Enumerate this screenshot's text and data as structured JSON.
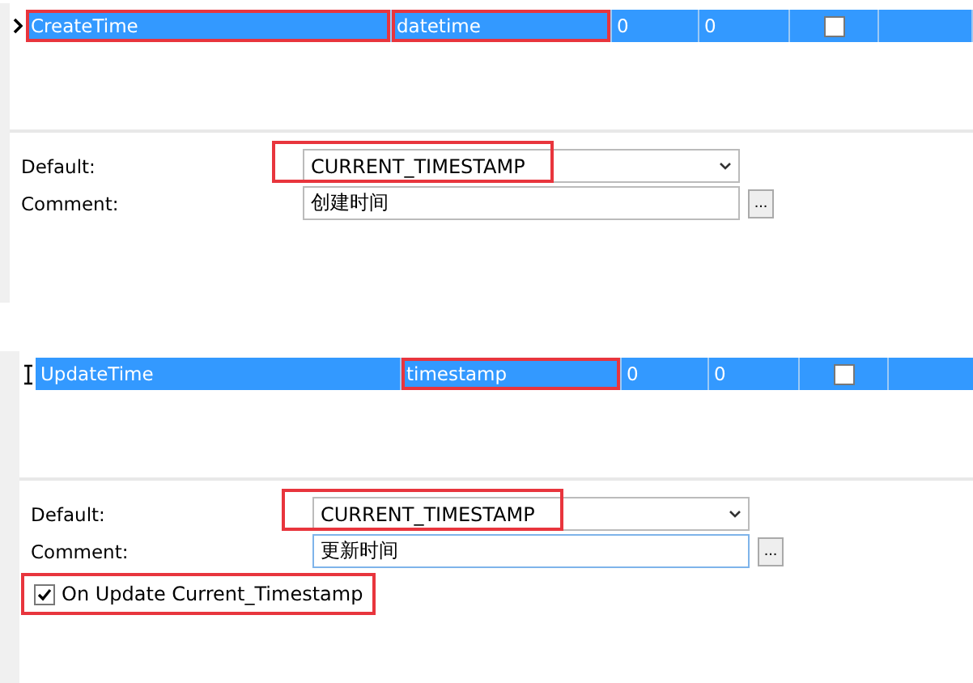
{
  "panels": [
    {
      "row": {
        "kind": "pointer",
        "selected": true,
        "cells": [
          {
            "kind": "text",
            "text": "CreateTime",
            "highlighted": true
          },
          {
            "kind": "text",
            "text": "datetime",
            "highlighted": true
          },
          {
            "kind": "text",
            "text": "0",
            "highlighted": false
          },
          {
            "kind": "text",
            "text": "0",
            "highlighted": false
          },
          {
            "kind": "check",
            "checked": false,
            "highlighted": false
          },
          {
            "kind": "text",
            "text": "",
            "highlighted": false
          }
        ]
      },
      "default": {
        "label": "Default:",
        "value": "CURRENT_TIMESTAMP",
        "highlighted": true
      },
      "comment": {
        "label": "Comment:",
        "value": "创建时间",
        "focused": false,
        "button": "..."
      }
    },
    {
      "row": {
        "kind": "editing",
        "selected": true,
        "cells": [
          {
            "kind": "text",
            "text": "UpdateTime",
            "highlighted": false
          },
          {
            "kind": "text",
            "text": "timestamp",
            "highlighted": true
          },
          {
            "kind": "text",
            "text": "0",
            "highlighted": false
          },
          {
            "kind": "text",
            "text": "0",
            "highlighted": false
          },
          {
            "kind": "check",
            "checked": false,
            "highlighted": false
          },
          {
            "kind": "text",
            "text": "",
            "highlighted": false
          }
        ]
      },
      "default": {
        "label": "Default:",
        "value": "CURRENT_TIMESTAMP",
        "highlighted": true
      },
      "comment": {
        "label": "Comment:",
        "value": "更新时间",
        "focused": true,
        "button": "..."
      },
      "on_update": {
        "label": "On Update Current_Timestamp",
        "checked": true,
        "highlighted": true
      }
    }
  ]
}
